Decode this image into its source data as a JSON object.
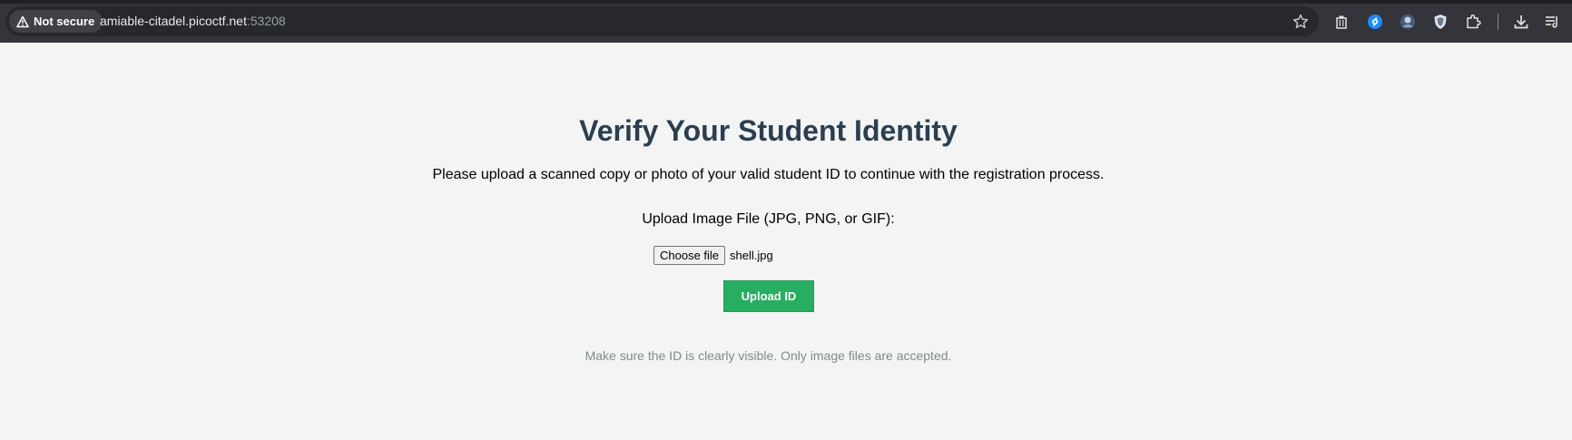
{
  "browser": {
    "security_label": "Not secure",
    "url_host": "amiable-citadel.picoctf.net",
    "url_port": ":53208",
    "icons": [
      "warning-icon",
      "bookmark-star-icon",
      "trash-icon",
      "shazam-icon",
      "avatar-extension-icon",
      "shield-extension-icon",
      "extensions-puzzle-icon",
      "download-icon",
      "media-queue-icon"
    ]
  },
  "page": {
    "title": "Verify Your Student Identity",
    "description": "Please upload a scanned copy or photo of your valid student ID to continue with the registration process.",
    "upload_label": "Upload Image File (JPG, PNG, or GIF):",
    "choose_file_label": "Choose file",
    "selected_file": "shell.jpg",
    "submit_label": "Upload ID",
    "hint": "Make sure the ID is clearly visible. Only image files are accepted."
  },
  "colors": {
    "title": "#2c3e50",
    "button": "#27ae60",
    "hint": "#7f8c8d",
    "background": "#f4f4f4"
  }
}
